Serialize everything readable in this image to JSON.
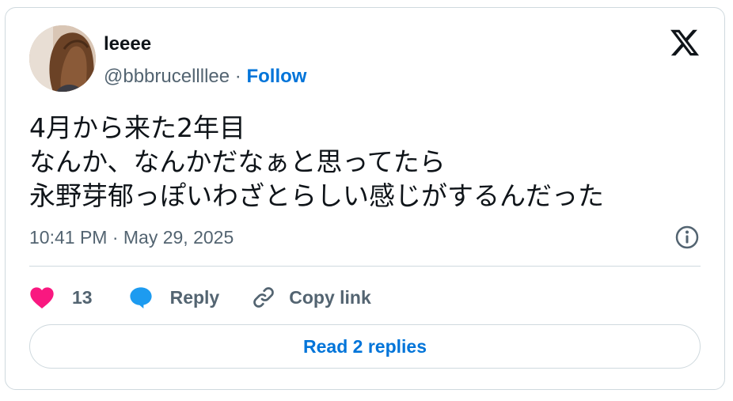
{
  "author": {
    "name": "leeee",
    "handle": "@bbbrucellllee",
    "separator": " · ",
    "follow_label": "Follow"
  },
  "tweet": {
    "lines": [
      "4月から来た2年目",
      "なんか、なんかだなぁと思ってたら",
      "永野芽郁っぽいわざとらしい感じがするんだった"
    ],
    "timestamp": "10:41 PM · May 29, 2025"
  },
  "actions": {
    "like_count": "13",
    "reply_label": "Reply",
    "copy_label": "Copy link"
  },
  "read_replies_label": "Read 2 replies",
  "colors": {
    "accent": "#0074d9",
    "like": "#f91880",
    "reply": "#1d9bf0",
    "muted": "#536471",
    "text": "#0f1419",
    "border": "#cfd9de"
  }
}
